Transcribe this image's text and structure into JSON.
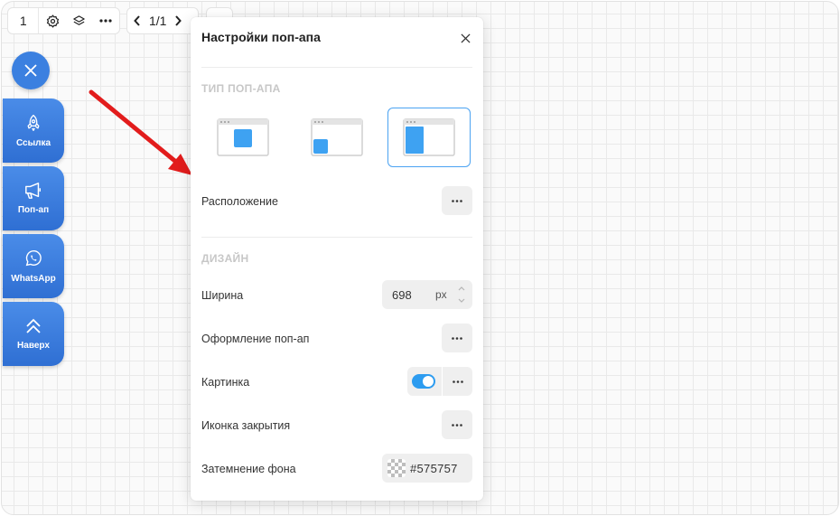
{
  "toolbar": {
    "page_number": "1",
    "pagination": "1/1",
    "icons": [
      "gear-icon",
      "layers-icon",
      "more-icon",
      "chevron-left-icon",
      "chevron-right-icon"
    ]
  },
  "sidebar": {
    "close_icon": "close-icon",
    "buttons": [
      {
        "label": "Ссылка",
        "icon": "rocket-icon"
      },
      {
        "label": "Поп-ап",
        "icon": "megaphone-icon"
      },
      {
        "label": "WhatsApp",
        "icon": "whatsapp-icon"
      },
      {
        "label": "Наверх",
        "icon": "double-chevron-up-icon"
      }
    ]
  },
  "annotation": {
    "icon": "red-arrow",
    "color": "#e21c1c"
  },
  "panel": {
    "title": "Настройки поп-апа",
    "type_section": "ТИП ПОП-АПА",
    "type_options": [
      "center-popup",
      "bottom-left-popup",
      "side-panel-popup"
    ],
    "selected_type": 2,
    "rows": {
      "position": "Расположение",
      "design_section": "ДИЗАЙН",
      "width_label": "Ширина",
      "width_value": "698",
      "width_unit": "px",
      "style_label": "Оформление поп-ап",
      "image_label": "Картинка",
      "image_enabled": true,
      "close_icon_label": "Иконка закрытия",
      "overlay_label": "Затемнение фона",
      "overlay_color": "#575757"
    },
    "accent_color": "#2d9cf0"
  }
}
